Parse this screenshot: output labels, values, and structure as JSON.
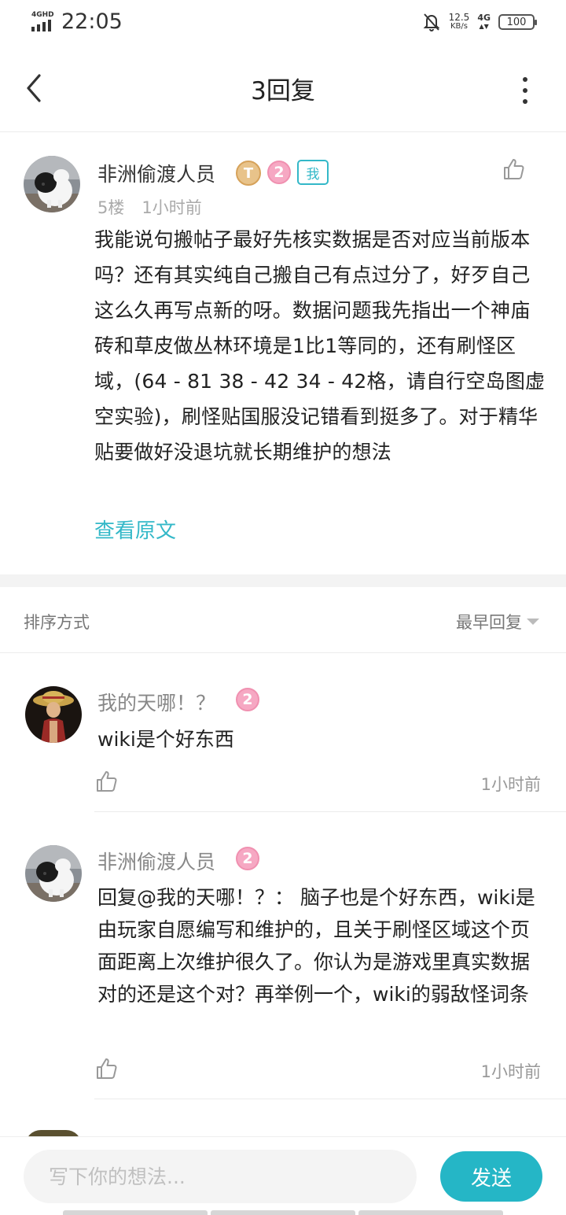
{
  "status_bar": {
    "network_label": "4GHD",
    "time": "22:05",
    "speed_value": "12.5",
    "speed_unit": "KB/s",
    "net_type": "4G",
    "battery": "100"
  },
  "header": {
    "title": "3回复",
    "back_icon": "chevron-left-icon",
    "more_icon": "more-vertical-icon"
  },
  "post": {
    "username": "非洲偷渡人员",
    "title_badge": "T",
    "level_badge": "2",
    "me_tag": "我",
    "floor": "5楼",
    "time": "1小时前",
    "body": "我能说句搬帖子最好先核实数据是否对应当前版本吗？还有其实纯自己搬自己有点过分了，好歹自己这么久再写点新的呀。数据问题我先指出一个神庙砖和草皮做丛林环境是1比1等同的，还有刷怪区域，(64 - 81 38 - 42 34 - 42格，请自行空岛图虚空实验)，刷怪贴国服没记错看到挺多了。对于精华贴要做好没退坑就长期维护的想法",
    "view_original": "查看原文"
  },
  "sort": {
    "label": "排序方式",
    "value": "最早回复"
  },
  "replies": [
    {
      "username": "我的天哪！？",
      "level_badge": "2",
      "body": "wiki是个好东西",
      "time": "1小时前"
    },
    {
      "username": "非洲偷渡人员",
      "level_badge": "2",
      "body": "回复@我的天哪！？：  脑子也是个好东西，wiki是由玩家自愿编写和维护的，且关于刷怪区域这个页面距离上次维护很久了。你认为是游戏里真实数据对的还是这个对？再举例一个，wiki的弱敌怪词条",
      "time": "1小时前"
    }
  ],
  "composer": {
    "placeholder": "写下你的想法...",
    "send_label": "发送"
  },
  "colors": {
    "accent": "#25b6c6",
    "level_badge": "#f6a8c3",
    "title_badge": "#e8c38a"
  }
}
